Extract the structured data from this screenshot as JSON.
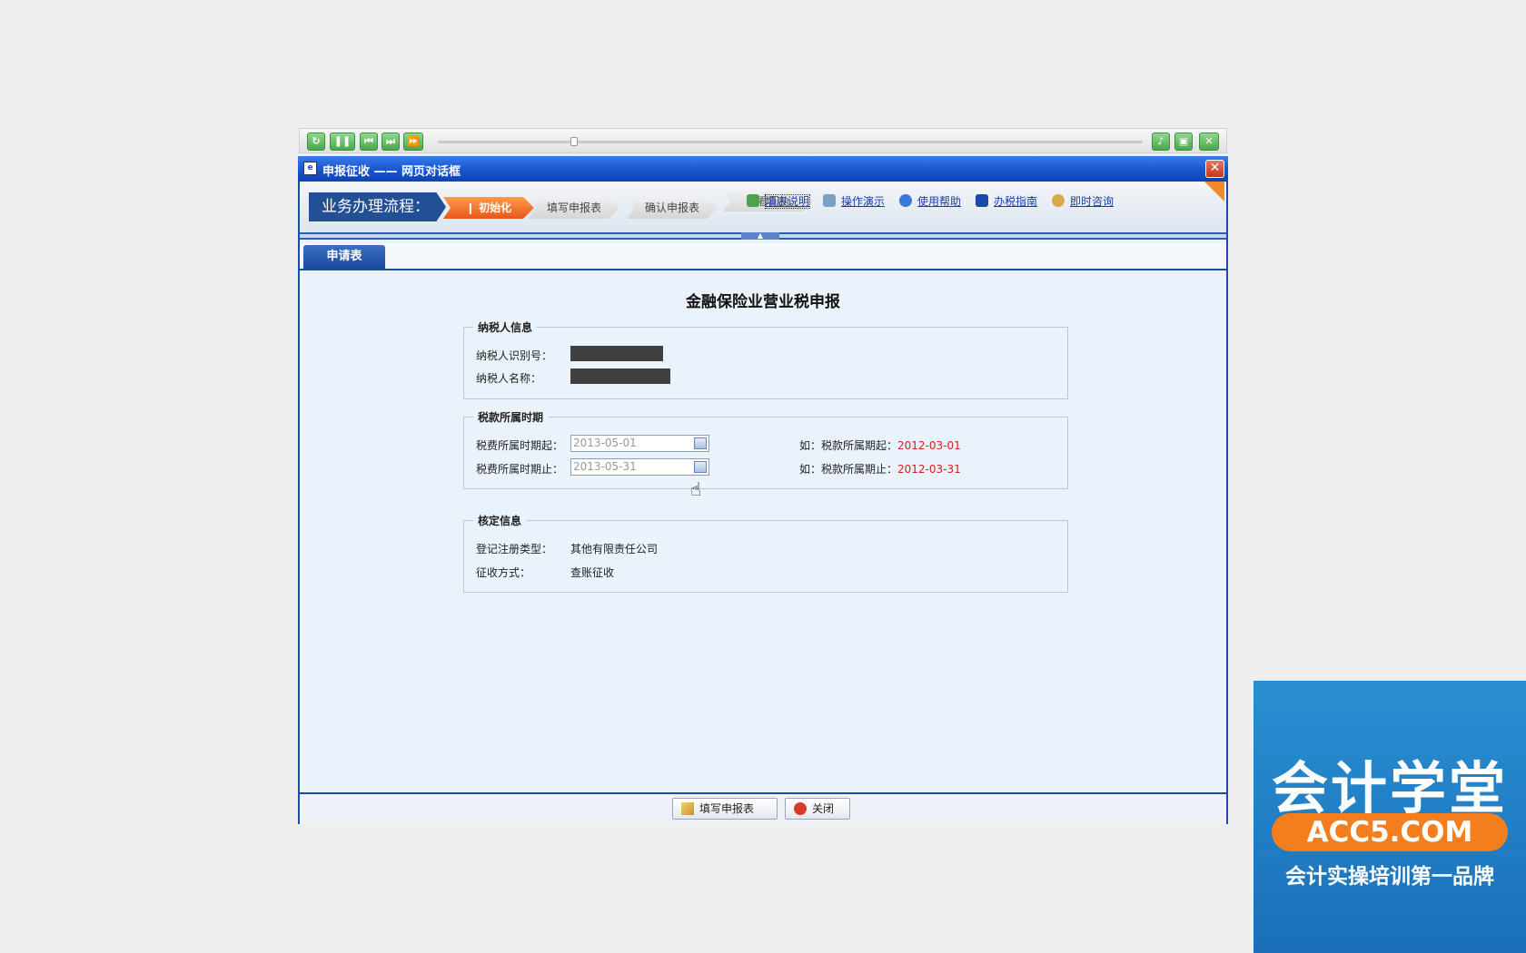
{
  "player": {
    "buttons": [
      "replay-icon",
      "pause-icon",
      "prev-icon",
      "next-icon",
      "fast-forward-icon"
    ],
    "right_buttons": [
      "volume-icon",
      "save-icon",
      "close-icon"
    ]
  },
  "dialog": {
    "title": "申报征收 —— 网页对话框",
    "close_glyph": "✕"
  },
  "process": {
    "label": "业务办理流程：",
    "steps": [
      "初始化",
      "填写申报表",
      "确认申报表",
      "查看回执"
    ],
    "active_step": 0,
    "links": [
      "填表说明",
      "操作演示",
      "使用帮助",
      "办税指南",
      "即时咨询"
    ]
  },
  "tabs": [
    "申请表"
  ],
  "form": {
    "title": "金融保险业营业税申报",
    "taxpayer": {
      "legend": "纳税人信息",
      "id_label": "纳税人识别号：",
      "name_label": "纳税人名称："
    },
    "period": {
      "legend": "税款所属时期",
      "start_label": "税费所属时期起：",
      "start_value": "2013-05-01",
      "end_label": "税费所属时期止：",
      "end_value": "2013-05-31",
      "start_hint": "如：税款所属期起：",
      "start_hint_example": "2012-03-01",
      "end_hint": "如：税款所属期止：",
      "end_hint_example": "2012-03-31"
    },
    "assessment": {
      "legend": "核定信息",
      "reg_type_label": "登记注册类型：",
      "reg_type_value": "其他有限责任公司",
      "collect_label": "征收方式：",
      "collect_value": "查账征收"
    }
  },
  "buttons": {
    "fill": "填写申报表",
    "close": "关闭"
  },
  "watermark": {
    "title": "会计学堂",
    "domain": "ACC5.COM",
    "slogan": "会计实操培训第一品牌"
  },
  "colors": {
    "accent_blue": "#1c4aa6",
    "active_step": "#e8561a",
    "hint_red": "#d22020",
    "brand_orange": "#f47d1e"
  }
}
